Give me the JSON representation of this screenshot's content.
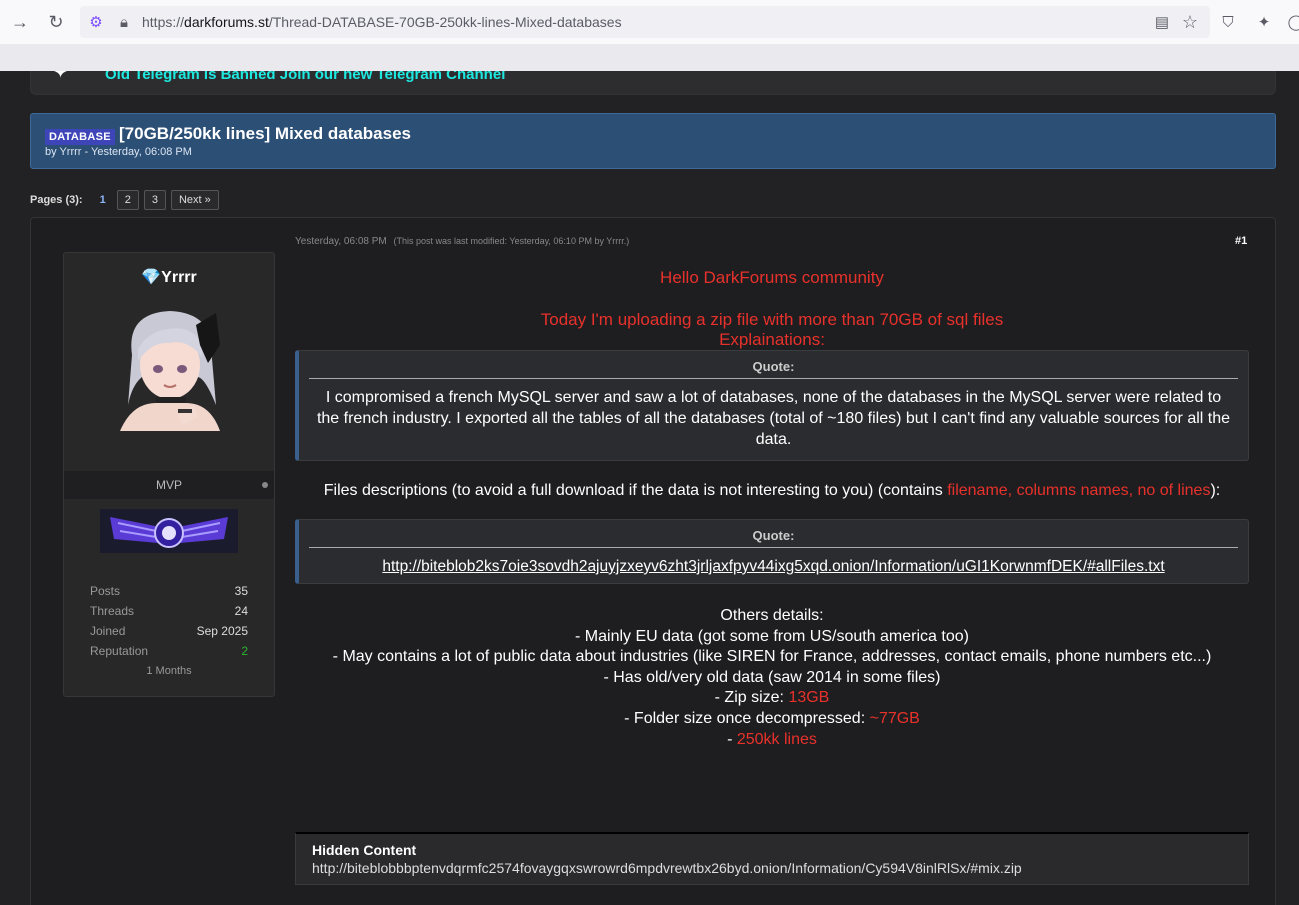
{
  "browser": {
    "url_prefix": "https://",
    "url_domain": "darkforums.st",
    "url_path": "/Thread-DATABASE-70GB-250kk-lines-Mixed-databases"
  },
  "announcement": {
    "text": "Old Telegram is Banned Join our new Telegram Channel"
  },
  "thread": {
    "prefix": "DATABASE",
    "title": "[70GB/250kk lines] Mixed databases",
    "byline": "by Yrrrr - Yesterday, 06:08 PM"
  },
  "pagination": {
    "label": "Pages (3):",
    "current": "1",
    "pages": [
      "2",
      "3"
    ],
    "next": "Next »"
  },
  "user": {
    "name": "💎Yrrrr",
    "rank": "MVP",
    "stats": [
      {
        "label": "Posts",
        "value": "35"
      },
      {
        "label": "Threads",
        "value": "24"
      },
      {
        "label": "Joined",
        "value": "Sep 2025"
      },
      {
        "label": "Reputation",
        "value": "2"
      }
    ],
    "months": "1 Months"
  },
  "post": {
    "date": "Yesterday, 06:08 PM",
    "modified": "(This post was last modified: Yesterday, 06:10 PM by Yrrrr.)",
    "number": "#1",
    "greeting": "Hello DarkForums community",
    "intro": "Today I'm uploading a zip file with more than 70GB of sql files",
    "explanations": "Explainations:",
    "quote1_header": "Quote:",
    "quote1_text": "I compromised a french MySQL server and saw a lot of databases, none of the databases in the MySQL server were related to the french industry. I exported all the tables of all the databases (total of ~180 files) but I can't find any valuable sources for all the data.",
    "files_desc": "Files descriptions (to avoid a full download if the data is not interesting to you) (contains",
    "files_desc_red": "filename, columns names, no of lines",
    "files_desc_end": "):",
    "quote2_header": "Quote:",
    "quote2_link": "http://biteblob2ks7oie3sovdh2ajuyjzxeyv6zht3jrljaxfpyv44ixg5xqd.onion/Information/uGI1KorwnmfDEK/#allFiles.txt",
    "others_title": "Others details:",
    "d1": "- Mainly EU data (got some from US/south america too)",
    "d2": "- May contains a lot of public data about industries (like SIREN for France, addresses, contact emails, phone numbers etc...)",
    "d3": "- Has old/very old data (saw 2014 in some files)",
    "d4_label": "- Zip size:",
    "d4_value": "13GB",
    "d5_label": "- Folder size once decompressed:",
    "d5_value": "~77GB",
    "d6_label": "-",
    "d6_value": "250kk lines",
    "hidden_title": "Hidden Content",
    "hidden_link": "http://biteblobbbptenvdqrmfc2574fovaygqxswrowrd6mpdvrewtbx26byd.onion/Information/Cy594V8inlRlSx/#mix.zip"
  }
}
